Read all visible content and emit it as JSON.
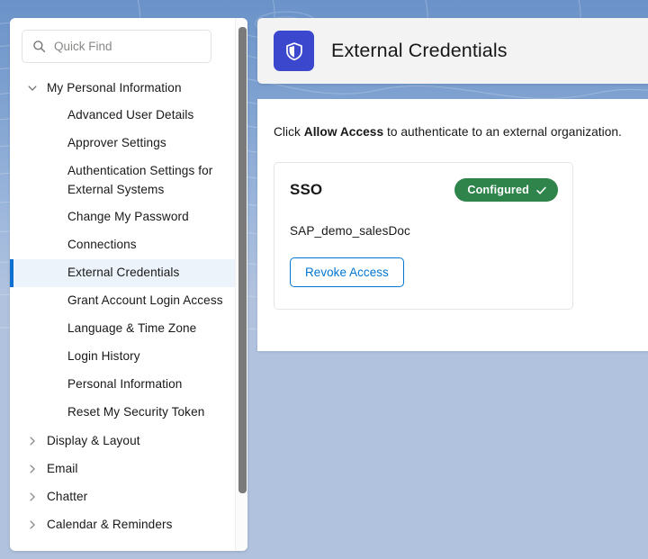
{
  "colors": {
    "background_blue": "#b0c2de",
    "brand_blue": "#0176d3",
    "app_icon_bg": "#3b47cc",
    "status_green": "#2e844a",
    "selected_item_bg": "#ecf3fb",
    "selected_item_border": "#0d6fd1",
    "header_card_bg": "#f3f3f3"
  },
  "sidebar": {
    "search": {
      "placeholder": "Quick Find",
      "value": "",
      "icon": "search-icon"
    },
    "groups": [
      {
        "label": "My Personal Information",
        "expanded": true,
        "icon": "chevron-down-icon",
        "items": [
          {
            "label": "Advanced User Details",
            "selected": false
          },
          {
            "label": "Approver Settings",
            "selected": false
          },
          {
            "label": "Authentication Settings for External Systems",
            "selected": false
          },
          {
            "label": "Change My Password",
            "selected": false
          },
          {
            "label": "Connections",
            "selected": false
          },
          {
            "label": "External Credentials",
            "selected": true
          },
          {
            "label": "Grant Account Login Access",
            "selected": false
          },
          {
            "label": "Language & Time Zone",
            "selected": false
          },
          {
            "label": "Login History",
            "selected": false
          },
          {
            "label": "Personal Information",
            "selected": false
          },
          {
            "label": "Reset My Security Token",
            "selected": false
          }
        ]
      },
      {
        "label": "Display & Layout",
        "expanded": false,
        "icon": "chevron-right-icon",
        "items": []
      },
      {
        "label": "Email",
        "expanded": false,
        "icon": "chevron-right-icon",
        "items": []
      },
      {
        "label": "Chatter",
        "expanded": false,
        "icon": "chevron-right-icon",
        "items": []
      },
      {
        "label": "Calendar & Reminders",
        "expanded": false,
        "icon": "chevron-right-icon",
        "items": []
      }
    ]
  },
  "header": {
    "title": "External Credentials",
    "icon": "shield-icon"
  },
  "main": {
    "instruction": {
      "prefix": "Click ",
      "emphasis": "Allow Access",
      "suffix": " to authenticate to an external organization."
    },
    "cards": [
      {
        "title": "SSO",
        "status_label": "Configured",
        "status_icon": "check-icon",
        "credential_name": "SAP_demo_salesDoc",
        "action_label": "Revoke Access"
      }
    ]
  }
}
